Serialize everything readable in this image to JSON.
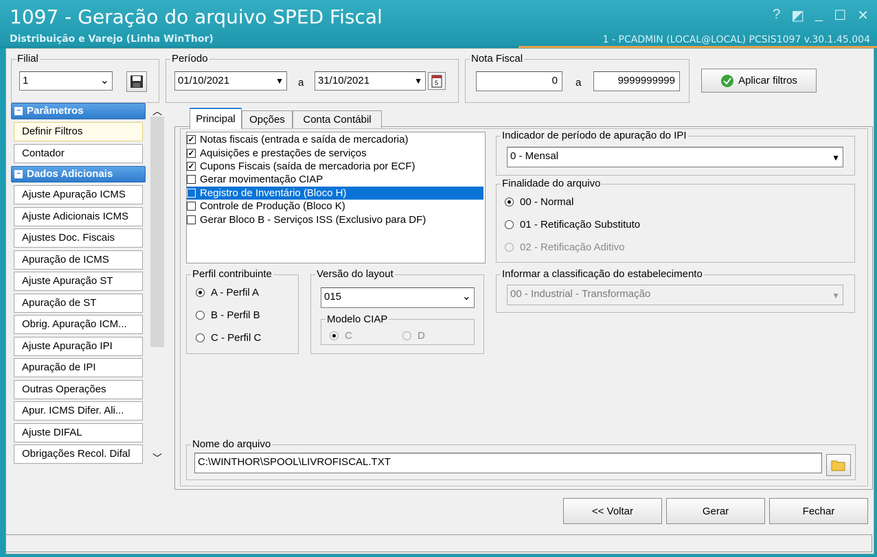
{
  "window": {
    "title": "1097 - Geração do arquivo SPED Fiscal",
    "subtitle": "Distribuição e Varejo (Linha WinThor)",
    "user_info": "1 - PCADMIN (LOCAL@LOCAL)   PCSIS1097  v.30.1.45.004",
    "controls": {
      "help": "?",
      "restore": "◩",
      "minimize": "_",
      "maximize": "☐",
      "close": "✕"
    }
  },
  "filters": {
    "filial_label": "Filial",
    "filial_value": "1",
    "periodo_label": "Período",
    "date_from": "01/10/2021",
    "date_sep": "a",
    "date_to": "31/10/2021",
    "nota_label": "Nota Fiscal",
    "nota_from": "0",
    "nota_sep": "a",
    "nota_to": "9999999999",
    "apply_button": "Aplicar filtros"
  },
  "nav": {
    "section1": "Parâmetros",
    "items1": [
      "Definir Filtros",
      "Contador"
    ],
    "section2": "Dados Adicionais",
    "items2": [
      "Ajuste Apuração ICMS",
      "Ajuste Adicionais ICMS",
      "Ajustes Doc. Fiscais",
      "Apuração de ICMS",
      "Ajuste Apuração ST",
      "Apuração de ST",
      "Obrig. Apuração ICM...",
      "Ajuste Apuração IPI",
      "Apuração de IPI",
      "Outras Operações",
      "Apur. ICMS Difer. Ali...",
      "Ajuste DIFAL",
      "Obrigações Recol. Difal"
    ]
  },
  "tabs": [
    "Principal",
    "Opções",
    "Conta Contábil"
  ],
  "checklist": [
    {
      "label": "Notas fiscais (entrada e saída de mercadoria)",
      "checked": true
    },
    {
      "label": "Aquisições e prestações de serviços",
      "checked": true
    },
    {
      "label": "Cupons Fiscais (saída de mercadoria por ECF)",
      "checked": true
    },
    {
      "label": "Gerar movimentação CIAP",
      "checked": false
    },
    {
      "label": "Registro de Inventário (Bloco H)",
      "checked": false
    },
    {
      "label": "Controle de Produção (Bloco K)",
      "checked": false
    },
    {
      "label": "Gerar Bloco B - Serviços ISS (Exclusivo para DF)",
      "checked": false
    }
  ],
  "ipi": {
    "label": "Indicador de período de apuração do IPI",
    "value": "0 - Mensal"
  },
  "finalidade": {
    "label": "Finalidade do arquivo",
    "options": [
      "00 - Normal",
      "01 - Retificação Substituto",
      "02 - Retificação Aditivo"
    ]
  },
  "perfil": {
    "label": "Perfil contribuinte",
    "options": [
      "A - Perfil A",
      "B - Perfil B",
      "C - Perfil C"
    ]
  },
  "layout": {
    "label": "Versão do layout",
    "value": "015",
    "ciap_label": "Modelo CIAP",
    "ciap_options": [
      "C",
      "D"
    ]
  },
  "classificacao": {
    "label": "Informar a classificação do estabelecimento",
    "value": "00 - Industrial - Transformação"
  },
  "arquivo": {
    "label": "Nome do arquivo",
    "value": "C:\\WINTHOR\\SPOOL\\LIVROFISCAL.TXT"
  },
  "buttons": {
    "voltar": "<< Voltar",
    "gerar": "Gerar",
    "fechar": "Fechar"
  }
}
